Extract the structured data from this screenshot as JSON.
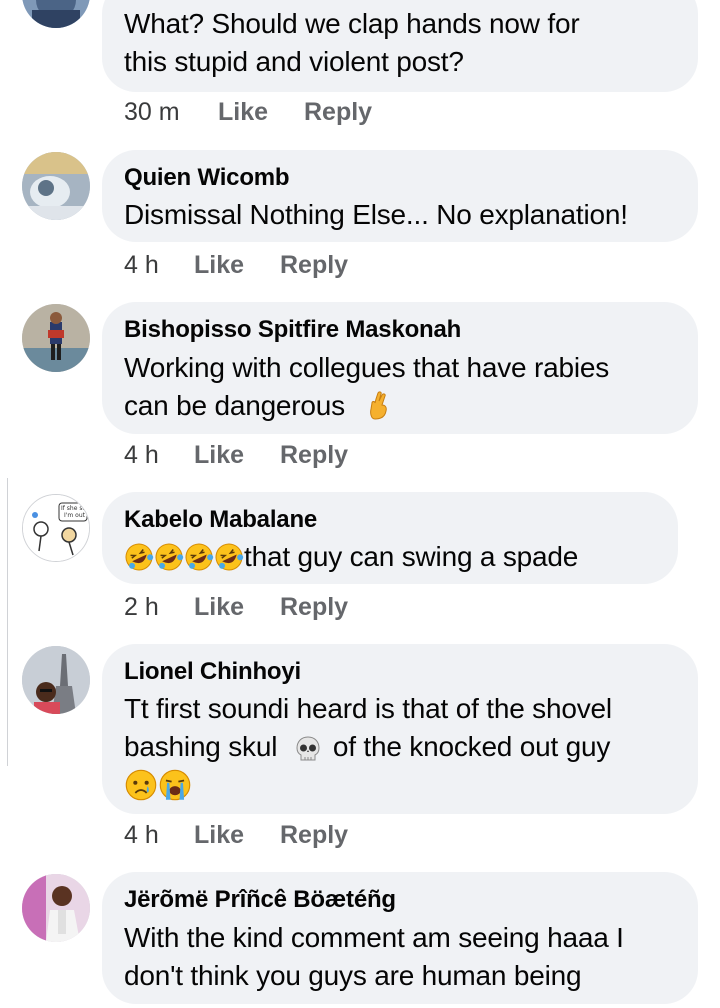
{
  "comments": [
    {
      "author": "",
      "text_lines": [
        "What? Should we clap hands now for",
        "this stupid and violent post?"
      ],
      "time": "30 m",
      "like": "Like",
      "reply": "Reply"
    },
    {
      "author": "Quien Wicomb",
      "text_lines": [
        "Dismissal Nothing Else... No explanation!"
      ],
      "time": "4 h",
      "like": "Like",
      "reply": "Reply"
    },
    {
      "author": "Bishopisso Spitfire Maskonah",
      "text_lines": [
        "Working with collegues that have  rabies",
        "can be dangerous"
      ],
      "emoji_after_line2": "crossed-fingers-emoji",
      "time": "4 h",
      "like": "Like",
      "reply": "Reply"
    },
    {
      "author": "Kabelo Mabalane",
      "text_lines": [
        "that guy can swing a spade"
      ],
      "emoji_before_line1": [
        "rolling-laughing-emoji",
        "rolling-laughing-emoji",
        "rolling-laughing-emoji",
        "rolling-laughing-emoji"
      ],
      "time": "2 h",
      "like": "Like",
      "reply": "Reply"
    },
    {
      "author": "Lionel Chinhoyi",
      "text_lines": [
        "Tt first soundi heard is that of  the shovel",
        "bashing  skul",
        "of the knocked out guy"
      ],
      "emoji_line3": [
        "sad-tear-emoji",
        "crying-emoji"
      ],
      "time": "4 h",
      "like": "Like",
      "reply": "Reply"
    },
    {
      "author": "Jërõmë Prîñcê Böætéñg",
      "text_lines": [
        "With the kind comment am seeing haaa I",
        "don't think you guys are human being"
      ]
    }
  ],
  "avatar_image_text": [
    "If she sh",
    "I'm out"
  ],
  "colors": {
    "bubble": "#f0f2f5",
    "meta_action": "#65676b",
    "text": "#050505"
  }
}
